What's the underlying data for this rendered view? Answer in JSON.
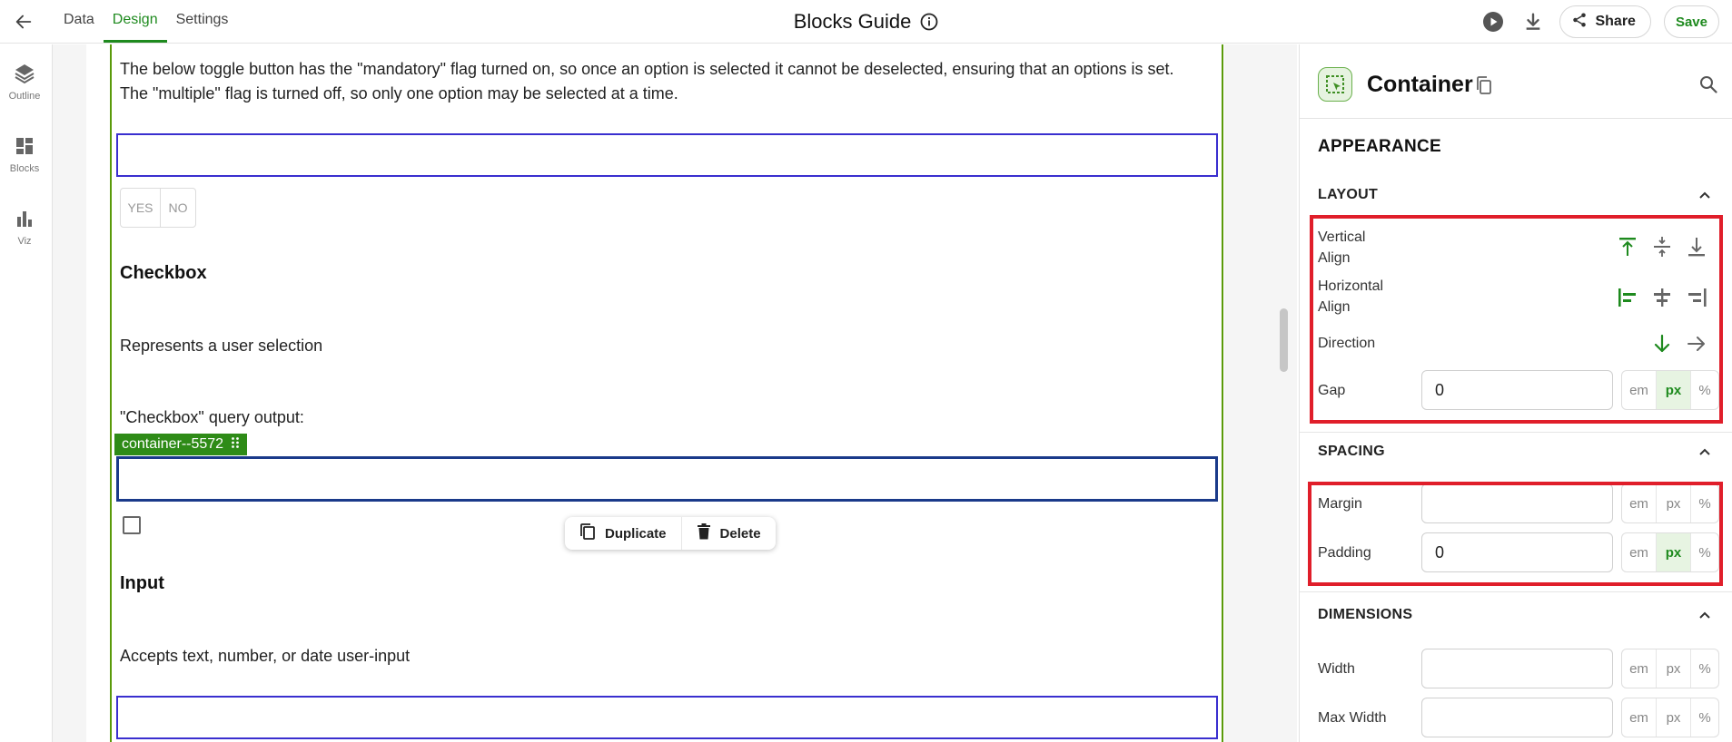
{
  "topbar": {
    "tabs": [
      {
        "label": "Data",
        "active": false
      },
      {
        "label": "Design",
        "active": true
      },
      {
        "label": "Settings",
        "active": false
      }
    ],
    "title": "Blocks Guide",
    "share_label": "Share",
    "save_label": "Save"
  },
  "rail": {
    "items": [
      {
        "label": "Outline",
        "icon": "layers-icon"
      },
      {
        "label": "Blocks",
        "icon": "blocks-icon"
      },
      {
        "label": "Viz",
        "icon": "bar-chart-icon"
      }
    ]
  },
  "canvas": {
    "toggle_description_line1": "The below toggle button has the \"mandatory\" flag turned on, so once an option is selected it cannot be deselected, ensuring that an options is set.",
    "toggle_description_line2": "The \"multiple\" flag is turned off, so only one option may be selected at a time.",
    "toggle_options": [
      "YES",
      "NO"
    ],
    "checkbox_heading": "Checkbox",
    "checkbox_description": "Represents a user selection",
    "checkbox_query_label": "\"Checkbox\" query output:",
    "container_tag": "container--5572",
    "context_menu": {
      "duplicate_label": "Duplicate",
      "delete_label": "Delete"
    },
    "input_heading": "Input",
    "input_description": "Accepts text, number, or date user-input"
  },
  "panel": {
    "component_title": "Container",
    "appearance_label": "APPEARANCE",
    "layout": {
      "label": "LAYOUT",
      "vertical_align_line1": "Vertical",
      "vertical_align_line2": "Align",
      "horizontal_align_line1": "Horizontal",
      "horizontal_align_line2": "Align",
      "direction_label": "Direction",
      "gap_label": "Gap",
      "gap_value": "0",
      "gap_units": [
        "em",
        "px",
        "%"
      ],
      "gap_unit_selected": "px"
    },
    "spacing": {
      "label": "SPACING",
      "margin_label": "Margin",
      "margin_value": "",
      "margin_units": [
        "em",
        "px",
        "%"
      ],
      "padding_label": "Padding",
      "padding_value": "0",
      "padding_units": [
        "em",
        "px",
        "%"
      ],
      "padding_unit_selected": "px"
    },
    "dimensions": {
      "label": "DIMENSIONS",
      "width_label": "Width",
      "width_value": "",
      "width_units": [
        "em",
        "px",
        "%"
      ],
      "max_width_label": "Max Width",
      "max_width_value": "",
      "max_width_units": [
        "em",
        "px",
        "%"
      ]
    }
  },
  "colors": {
    "accent_green": "#1e8a1e",
    "container_tag_bg": "#2e8b17",
    "block_border": "#3a2fcf",
    "highlight_red": "#e01e2a"
  }
}
